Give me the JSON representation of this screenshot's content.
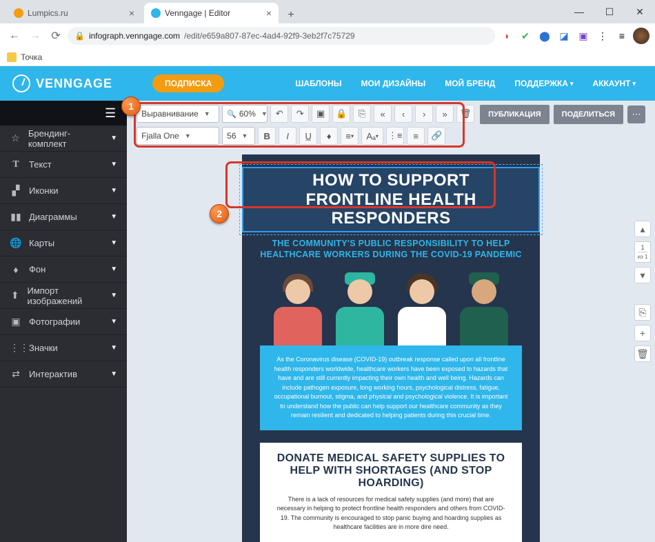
{
  "browser": {
    "tabs": [
      {
        "label": "Lumpics.ru",
        "active": false,
        "favicon": "#f39c12"
      },
      {
        "label": "Venngage | Editor",
        "active": true,
        "favicon": "#2fb6ea"
      }
    ],
    "url_domain": "infograph.venngage.com",
    "url_path": "/edit/e659a807-87ec-4ad4-92f9-3eb2f7c75729",
    "bookmark": "Точка",
    "ext_colors": [
      "#e04a3f",
      "#2fb64a",
      "#2b73d6",
      "#2b73d6",
      "#7a44c7",
      "#555"
    ]
  },
  "nav": {
    "brand": "VENNGAGE",
    "subscribe": "ПОДПИСКА",
    "links": [
      "ШАБЛОНЫ",
      "МОИ ДИЗАЙНЫ",
      "МОЙ БРЕНД",
      "ПОДДЕРЖКА",
      "АККАУНТ"
    ]
  },
  "sidebar": {
    "items": [
      {
        "icon": "☆",
        "label": "Брендинг-комплект"
      },
      {
        "icon": "T",
        "label": "Текст"
      },
      {
        "icon": "◧",
        "label": "Иконки"
      },
      {
        "icon": "◾",
        "label": "Диаграммы"
      },
      {
        "icon": "◍",
        "label": "Карты"
      },
      {
        "icon": "◊",
        "label": "Фон"
      },
      {
        "icon": "⤒",
        "label": "Импорт изображений"
      },
      {
        "icon": "▣",
        "label": "Фотографии"
      },
      {
        "icon": "⋮⋮",
        "label": "Значки"
      },
      {
        "icon": "⇄",
        "label": "Интерактив"
      }
    ]
  },
  "toolbar": {
    "align": "Выравнивание",
    "zoom": "60%",
    "font": "Fjalla One",
    "size": "56",
    "actions": {
      "publish": "ПУБЛИКАЦИЯ",
      "share": "ПОДЕЛИТЬСЯ"
    }
  },
  "canvas": {
    "headline1": "HOW TO SUPPORT",
    "headline2": "FRONTLINE HEALTH RESPONDERS",
    "sub1": "THE COMMUNITY'S PUBLIC RESPONSIBILITY TO HELP",
    "sub2": "HEALTHCARE WORKERS DURING THE COVID-19 PANDEMIC",
    "blurb": "As the Coronavirus disease (COVID-19) outbreak response called upon all frontline health responders worldwide, healthcare workers have been exposed to hazards that have and are still currently impacting their own health and well being. Hazards can include pathogen exposure, long working hours, psychological distress, fatigue, occupational burnout, stigma, and physical and psychological violence. It is important to understand how the public can help support our healthcare community as they remain resilient and dedicated to helping patients during this crucial time.",
    "box_title": "DONATE MEDICAL SAFETY SUPPLIES TO HELP WITH SHORTAGES (AND STOP HOARDING)",
    "box_body": "There is a lack of resources for medical safety supplies (and more) that are necessary in helping to protect frontline health responders and others from COVID-19. The community is encouraged to stop panic buying and hoarding supplies as healthcare facilities are in more dire need."
  },
  "rail": {
    "page": "1",
    "of": "из 1"
  },
  "callouts": {
    "one": "1",
    "two": "2"
  }
}
